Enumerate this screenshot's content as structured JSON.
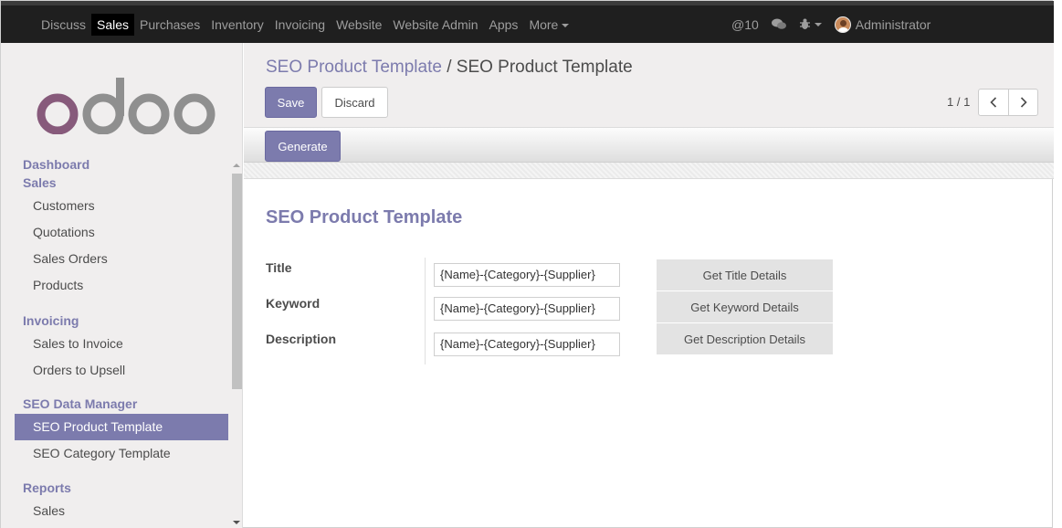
{
  "topbar": {
    "menu": [
      {
        "label": "Discuss"
      },
      {
        "label": "Sales",
        "active": true
      },
      {
        "label": "Purchases"
      },
      {
        "label": "Inventory"
      },
      {
        "label": "Invoicing"
      },
      {
        "label": "Website"
      },
      {
        "label": "Website Admin"
      },
      {
        "label": "Apps"
      },
      {
        "label": "More"
      }
    ],
    "notifications": "@10",
    "user": "Administrator"
  },
  "sidebar": {
    "logo_text": "odoo",
    "groups": [
      {
        "head": "Dashboard"
      },
      {
        "head": "Sales",
        "items": [
          "Customers",
          "Quotations",
          "Sales Orders",
          "Products"
        ]
      },
      {
        "head": "Invoicing",
        "items": [
          "Sales to Invoice",
          "Orders to Upsell"
        ]
      },
      {
        "head": "SEO Data Manager",
        "items": [
          "SEO Product Template",
          "SEO Category Template"
        ]
      },
      {
        "head": "Reports",
        "items": [
          "Sales"
        ]
      }
    ],
    "active_item": "SEO Product Template"
  },
  "control": {
    "breadcrumb_parent": "SEO Product Template",
    "breadcrumb_sep": "/",
    "breadcrumb_current": "SEO Product Template",
    "save_label": "Save",
    "discard_label": "Discard",
    "pager": "1 / 1"
  },
  "statusbar": {
    "generate_label": "Generate"
  },
  "form": {
    "title": "SEO Product Template",
    "fields": [
      {
        "label": "Title",
        "value": "{Name}-{Category}-{Supplier}",
        "button": "Get Title Details"
      },
      {
        "label": "Keyword",
        "value": "{Name}-{Category}-{Supplier}",
        "button": "Get Keyword Details"
      },
      {
        "label": "Description",
        "value": "{Name}-{Category}-{Supplier}",
        "button": "Get Description Details"
      }
    ]
  },
  "colors": {
    "accent": "#7c7bad",
    "logo_primary": "#875a7b",
    "logo_secondary": "#8f8f8f",
    "topbar": "#1f1f1f"
  }
}
